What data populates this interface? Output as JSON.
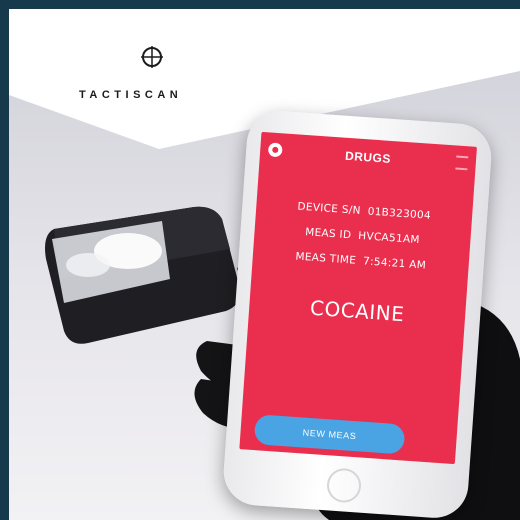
{
  "brand": {
    "name": "TACTISCAN",
    "logo_icon": "crosshair-circle-icon"
  },
  "app_screen": {
    "title": "DRUGS",
    "header_icon": "record-icon",
    "menu_icon": "menu-icon",
    "device_sn_label": "DEVICE S/N",
    "device_sn_value": "01B323004",
    "meas_id_label": "MEAS ID",
    "meas_id_value": "HVCA51AM",
    "meas_time_label": "MEAS TIME",
    "meas_time_value": "7:54:21 AM",
    "result": "COCAINE",
    "new_meas_button": "NEW MEAS"
  },
  "colors": {
    "frame_border": "#16394c",
    "screen_red": "#ea2f4e",
    "button_blue": "#4aa3e2"
  }
}
